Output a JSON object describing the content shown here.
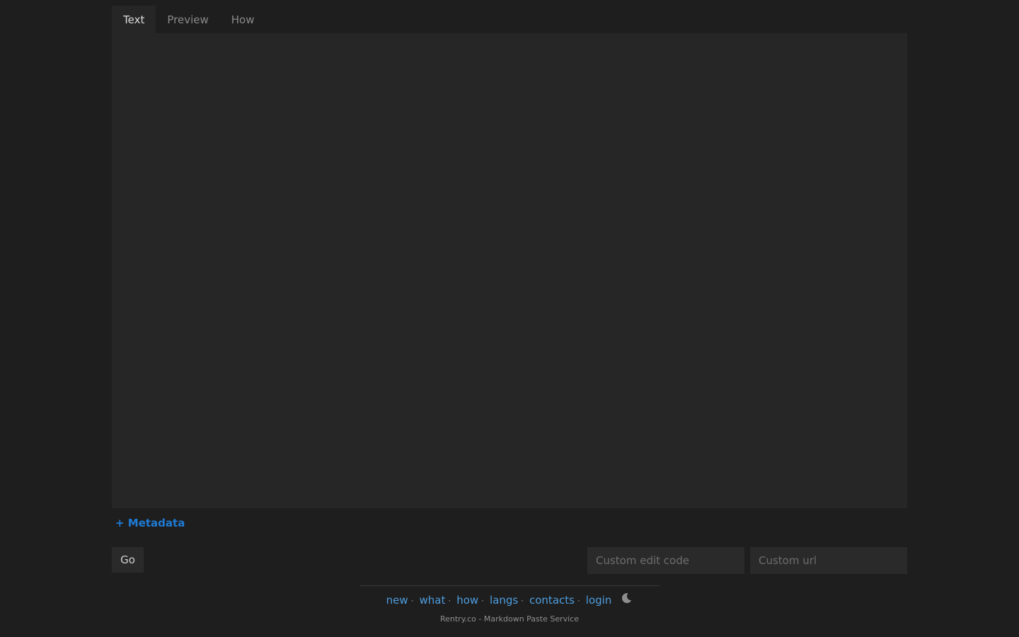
{
  "tabs": [
    {
      "label": "Text",
      "active": true
    },
    {
      "label": "Preview",
      "active": false
    },
    {
      "label": "How",
      "active": false
    }
  ],
  "editor": {
    "value": "",
    "placeholder": ""
  },
  "metadata_toggle": "+ Metadata",
  "go_button": "Go",
  "fields": {
    "edit_code_placeholder": "Custom edit code",
    "custom_url_placeholder": "Custom url"
  },
  "footer": {
    "links": [
      "new",
      "what",
      "how",
      "langs",
      "contacts",
      "login"
    ],
    "separator": "·",
    "theme_icon": "moon-icon",
    "tagline": "Rentry.co - Markdown Paste Service"
  },
  "colors": {
    "background": "#1e1e1e",
    "panel": "#262626",
    "link": "#4e9ee0",
    "metadata_link": "#1f7bd6"
  }
}
